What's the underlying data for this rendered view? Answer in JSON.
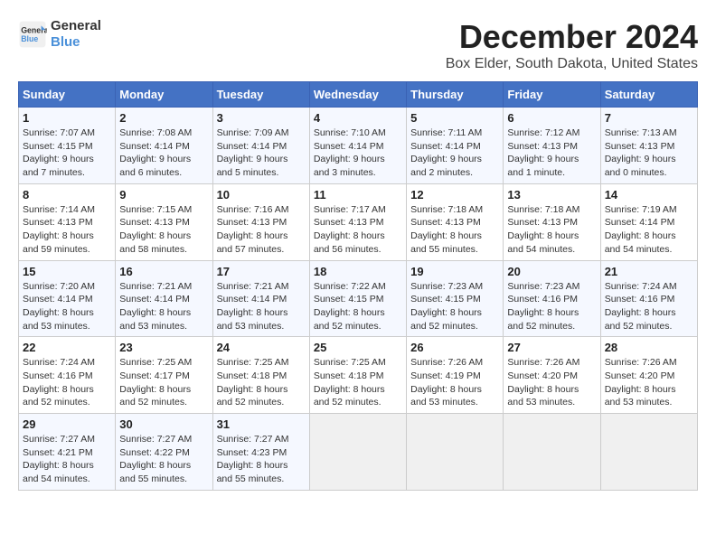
{
  "logo": {
    "line1": "General",
    "line2": "Blue"
  },
  "title": "December 2024",
  "location": "Box Elder, South Dakota, United States",
  "days_of_week": [
    "Sunday",
    "Monday",
    "Tuesday",
    "Wednesday",
    "Thursday",
    "Friday",
    "Saturday"
  ],
  "weeks": [
    [
      {
        "day": "1",
        "sunrise": "Sunrise: 7:07 AM",
        "sunset": "Sunset: 4:15 PM",
        "daylight": "Daylight: 9 hours and 7 minutes."
      },
      {
        "day": "2",
        "sunrise": "Sunrise: 7:08 AM",
        "sunset": "Sunset: 4:14 PM",
        "daylight": "Daylight: 9 hours and 6 minutes."
      },
      {
        "day": "3",
        "sunrise": "Sunrise: 7:09 AM",
        "sunset": "Sunset: 4:14 PM",
        "daylight": "Daylight: 9 hours and 5 minutes."
      },
      {
        "day": "4",
        "sunrise": "Sunrise: 7:10 AM",
        "sunset": "Sunset: 4:14 PM",
        "daylight": "Daylight: 9 hours and 3 minutes."
      },
      {
        "day": "5",
        "sunrise": "Sunrise: 7:11 AM",
        "sunset": "Sunset: 4:14 PM",
        "daylight": "Daylight: 9 hours and 2 minutes."
      },
      {
        "day": "6",
        "sunrise": "Sunrise: 7:12 AM",
        "sunset": "Sunset: 4:13 PM",
        "daylight": "Daylight: 9 hours and 1 minute."
      },
      {
        "day": "7",
        "sunrise": "Sunrise: 7:13 AM",
        "sunset": "Sunset: 4:13 PM",
        "daylight": "Daylight: 9 hours and 0 minutes."
      }
    ],
    [
      {
        "day": "8",
        "sunrise": "Sunrise: 7:14 AM",
        "sunset": "Sunset: 4:13 PM",
        "daylight": "Daylight: 8 hours and 59 minutes."
      },
      {
        "day": "9",
        "sunrise": "Sunrise: 7:15 AM",
        "sunset": "Sunset: 4:13 PM",
        "daylight": "Daylight: 8 hours and 58 minutes."
      },
      {
        "day": "10",
        "sunrise": "Sunrise: 7:16 AM",
        "sunset": "Sunset: 4:13 PM",
        "daylight": "Daylight: 8 hours and 57 minutes."
      },
      {
        "day": "11",
        "sunrise": "Sunrise: 7:17 AM",
        "sunset": "Sunset: 4:13 PM",
        "daylight": "Daylight: 8 hours and 56 minutes."
      },
      {
        "day": "12",
        "sunrise": "Sunrise: 7:18 AM",
        "sunset": "Sunset: 4:13 PM",
        "daylight": "Daylight: 8 hours and 55 minutes."
      },
      {
        "day": "13",
        "sunrise": "Sunrise: 7:18 AM",
        "sunset": "Sunset: 4:13 PM",
        "daylight": "Daylight: 8 hours and 54 minutes."
      },
      {
        "day": "14",
        "sunrise": "Sunrise: 7:19 AM",
        "sunset": "Sunset: 4:14 PM",
        "daylight": "Daylight: 8 hours and 54 minutes."
      }
    ],
    [
      {
        "day": "15",
        "sunrise": "Sunrise: 7:20 AM",
        "sunset": "Sunset: 4:14 PM",
        "daylight": "Daylight: 8 hours and 53 minutes."
      },
      {
        "day": "16",
        "sunrise": "Sunrise: 7:21 AM",
        "sunset": "Sunset: 4:14 PM",
        "daylight": "Daylight: 8 hours and 53 minutes."
      },
      {
        "day": "17",
        "sunrise": "Sunrise: 7:21 AM",
        "sunset": "Sunset: 4:14 PM",
        "daylight": "Daylight: 8 hours and 53 minutes."
      },
      {
        "day": "18",
        "sunrise": "Sunrise: 7:22 AM",
        "sunset": "Sunset: 4:15 PM",
        "daylight": "Daylight: 8 hours and 52 minutes."
      },
      {
        "day": "19",
        "sunrise": "Sunrise: 7:23 AM",
        "sunset": "Sunset: 4:15 PM",
        "daylight": "Daylight: 8 hours and 52 minutes."
      },
      {
        "day": "20",
        "sunrise": "Sunrise: 7:23 AM",
        "sunset": "Sunset: 4:16 PM",
        "daylight": "Daylight: 8 hours and 52 minutes."
      },
      {
        "day": "21",
        "sunrise": "Sunrise: 7:24 AM",
        "sunset": "Sunset: 4:16 PM",
        "daylight": "Daylight: 8 hours and 52 minutes."
      }
    ],
    [
      {
        "day": "22",
        "sunrise": "Sunrise: 7:24 AM",
        "sunset": "Sunset: 4:16 PM",
        "daylight": "Daylight: 8 hours and 52 minutes."
      },
      {
        "day": "23",
        "sunrise": "Sunrise: 7:25 AM",
        "sunset": "Sunset: 4:17 PM",
        "daylight": "Daylight: 8 hours and 52 minutes."
      },
      {
        "day": "24",
        "sunrise": "Sunrise: 7:25 AM",
        "sunset": "Sunset: 4:18 PM",
        "daylight": "Daylight: 8 hours and 52 minutes."
      },
      {
        "day": "25",
        "sunrise": "Sunrise: 7:25 AM",
        "sunset": "Sunset: 4:18 PM",
        "daylight": "Daylight: 8 hours and 52 minutes."
      },
      {
        "day": "26",
        "sunrise": "Sunrise: 7:26 AM",
        "sunset": "Sunset: 4:19 PM",
        "daylight": "Daylight: 8 hours and 53 minutes."
      },
      {
        "day": "27",
        "sunrise": "Sunrise: 7:26 AM",
        "sunset": "Sunset: 4:20 PM",
        "daylight": "Daylight: 8 hours and 53 minutes."
      },
      {
        "day": "28",
        "sunrise": "Sunrise: 7:26 AM",
        "sunset": "Sunset: 4:20 PM",
        "daylight": "Daylight: 8 hours and 53 minutes."
      }
    ],
    [
      {
        "day": "29",
        "sunrise": "Sunrise: 7:27 AM",
        "sunset": "Sunset: 4:21 PM",
        "daylight": "Daylight: 8 hours and 54 minutes."
      },
      {
        "day": "30",
        "sunrise": "Sunrise: 7:27 AM",
        "sunset": "Sunset: 4:22 PM",
        "daylight": "Daylight: 8 hours and 55 minutes."
      },
      {
        "day": "31",
        "sunrise": "Sunrise: 7:27 AM",
        "sunset": "Sunset: 4:23 PM",
        "daylight": "Daylight: 8 hours and 55 minutes."
      },
      null,
      null,
      null,
      null
    ]
  ]
}
